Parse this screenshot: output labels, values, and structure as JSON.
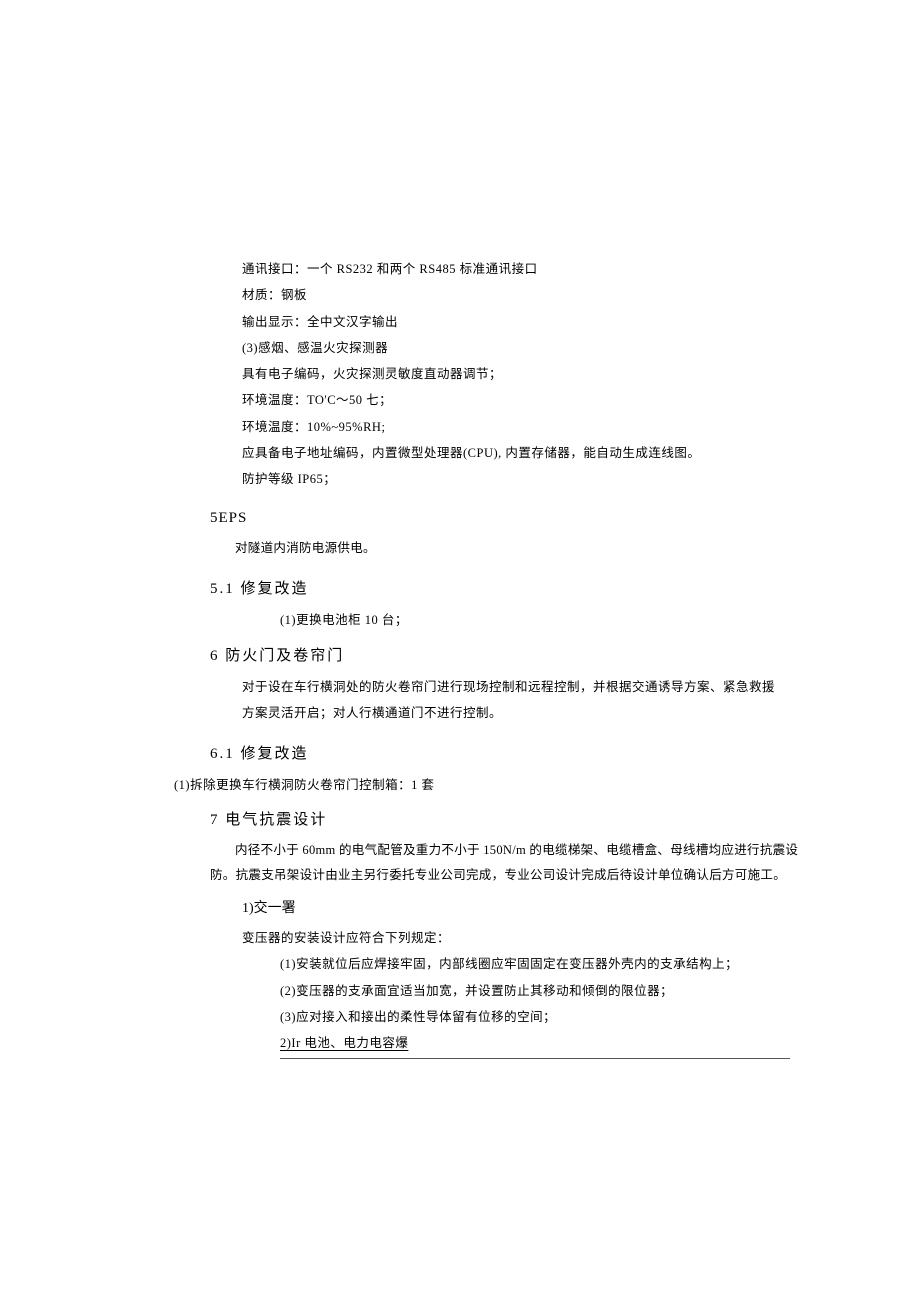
{
  "block1": {
    "l1": "通讯接口：一个 RS232 和两个 RS485 标准通讯接口",
    "l2": "材质：钢板",
    "l3": "输出显示：全中文汉字输出",
    "l4": "(3)感烟、感温火灾探测器",
    "l5": "具有电子编码，火灾探测灵敏度直动器调节；",
    "l6": "环境温度：TO'C～50 七；",
    "l7": "环境温度：10%~95%RH;",
    "l8": "应具备电子地址编码，内置微型处理器(CPU), 内置存储器，能自动生成连线图。",
    "l9": "防护等级 IP65；"
  },
  "sec5": {
    "heading": "5EPS",
    "para": "对隧道内消防电源供电。"
  },
  "sec5_1": {
    "heading": "5.1  修复改造",
    "item": "(1)更换电池柜 10 台；"
  },
  "sec6": {
    "heading": "6 防火门及卷帘门",
    "p1": "对于设在车行横洞处的防火卷帘门进行现场控制和远程控制，并根据交通诱导方案、紧急救援",
    "p2": "方案灵活开启；对人行横通道门不进行控制。"
  },
  "sec6_1": {
    "heading": "6.1 修复改造",
    "item": "(1)拆除更换车行横洞防火卷帘门控制箱：1 套"
  },
  "sec7": {
    "heading": "7 电气抗震设计",
    "p1": "内径不小于 60mm 的电气配管及重力不小于 150N/m 的电缆梯架、电缆槽盒、母线槽均应进行抗震设",
    "p2": "防。抗震支吊架设计由业主另行委托专业公司完成，专业公司设计完成后待设计单位确认后方可施工。"
  },
  "sub1": {
    "heading": "1)交一署",
    "lead": "变压器的安装设计应符合下列规定：",
    "i1": "(1)安装就位后应焊接牢固，内部线圈应牢固固定在变压器外壳内的支承结构上；",
    "i2": "(2)变压器的支承面宜适当加宽，并设置防止其移动和倾倒的限位器；",
    "i3": "(3)应对接入和接出的柔性导体留有位移的空间；"
  },
  "sub2": {
    "heading": "2)Ir 电池、电力电容爆"
  }
}
